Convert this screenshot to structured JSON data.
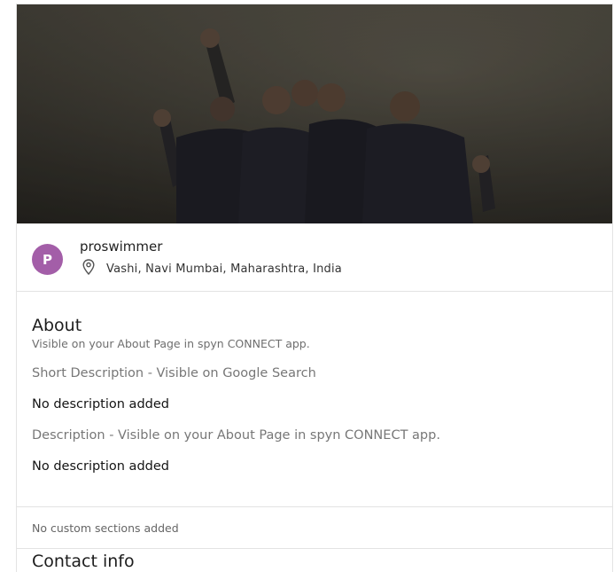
{
  "profile": {
    "avatar_letter": "P",
    "username": "proswimmer",
    "location": "Vashi, Navi Mumbai, Maharashtra, India",
    "avatar_color": "#a35ea8"
  },
  "about": {
    "title": "About",
    "subtitle": "Visible on your About Page in spyn CONNECT app.",
    "short_description_label": "Short Description - Visible on Google Search",
    "short_description_value": "No description added",
    "description_label": "Description - Visible on your About Page in spyn CONNECT app.",
    "description_value": "No description added"
  },
  "custom_sections": {
    "empty_text": "No custom sections added"
  },
  "contact": {
    "title": "Contact info"
  },
  "icons": {
    "location": "map-pin-icon"
  }
}
